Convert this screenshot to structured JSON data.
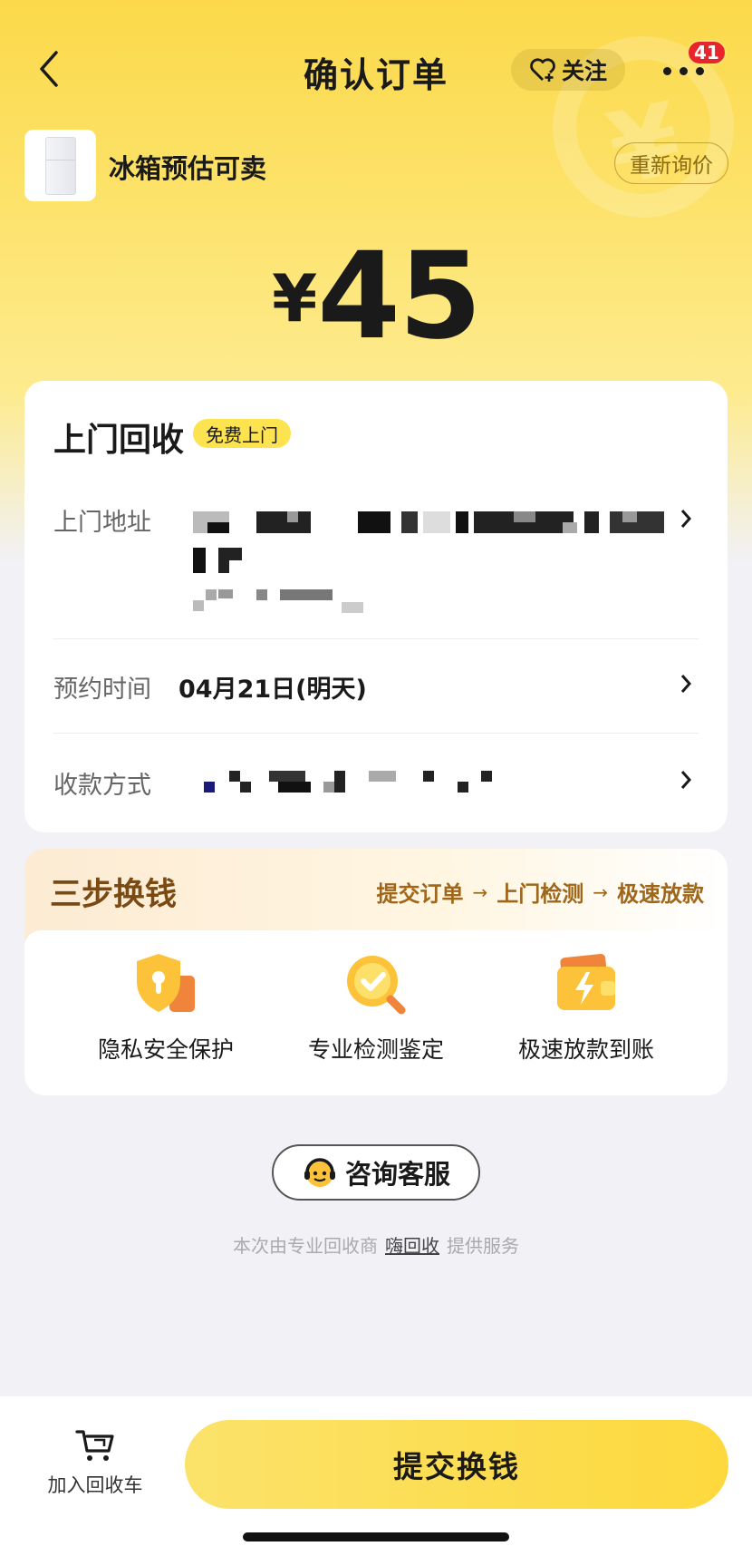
{
  "header": {
    "title": "确认订单",
    "follow_label": "关注",
    "notification_count": "41"
  },
  "product": {
    "name": "冰箱预估可卖",
    "requote_label": "重新询价",
    "price_symbol": "¥",
    "price_amount": "45"
  },
  "pickup": {
    "title": "上门回收",
    "tag": "免费上门",
    "address_label": "上门地址",
    "time_label": "预约时间",
    "time_value": "04月21日(明天)",
    "payment_label": "收款方式"
  },
  "steps": {
    "title": "三步换钱",
    "flow": [
      "提交订单",
      "上门检测",
      "极速放款"
    ],
    "features": [
      {
        "label": "隐私安全保护",
        "icon": "shield-lock-icon"
      },
      {
        "label": "专业检测鉴定",
        "icon": "check-magnifier-icon"
      },
      {
        "label": "极速放款到账",
        "icon": "lightning-wallet-icon"
      }
    ]
  },
  "support": {
    "consult_label": "咨询客服",
    "provider_prefix": "本次由专业回收商",
    "provider_name": "嗨回收",
    "provider_suffix": "提供服务"
  },
  "bottom": {
    "cart_label": "加入回收车",
    "submit_label": "提交换钱"
  },
  "colors": {
    "brand_yellow": "#fde34f",
    "accent_brown": "#a0661a",
    "badge_red": "#e8242c"
  }
}
